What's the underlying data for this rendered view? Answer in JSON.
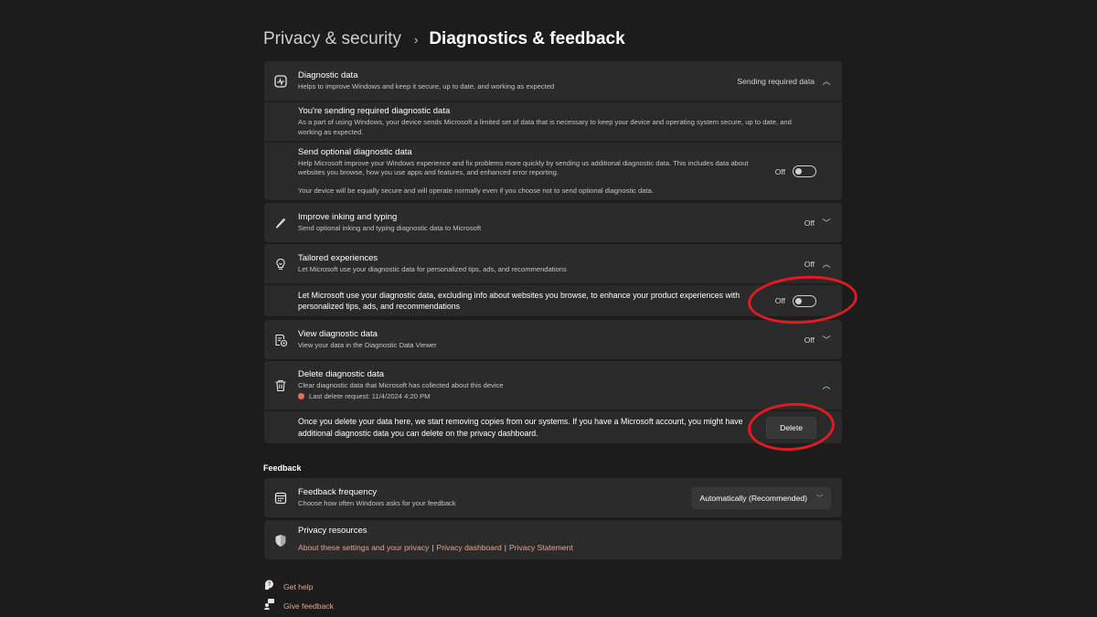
{
  "breadcrumb": {
    "parent": "Privacy & security",
    "separator": "›",
    "current": "Diagnostics & feedback"
  },
  "diagnostic_data": {
    "title": "Diagnostic data",
    "description": "Helps to improve Windows and keep it secure, up to date, and working as expected",
    "status": "Sending required data",
    "expanded": true,
    "required": {
      "title": "You're sending required diagnostic data",
      "description": "As a part of using Windows, your device sends Microsoft a limited set of data that is necessary to keep your device and operating system secure, up to date, and working as expected."
    },
    "optional": {
      "title": "Send optional diagnostic data",
      "description": "Help Microsoft improve your Windows experience and fix problems more quickly by sending us additional diagnostic data. This includes data about websites you browse, how you use apps and features, and enhanced error reporting.",
      "note": "Your device will be equally secure and will operate normally even if you choose not to send optional diagnostic data.",
      "toggle_label": "Off",
      "toggle_on": false
    }
  },
  "inking": {
    "title": "Improve inking and typing",
    "description": "Send optional inking and typing diagnostic data to Microsoft",
    "status": "Off"
  },
  "tailored": {
    "title": "Tailored experiences",
    "description": "Let Microsoft use your diagnostic data for personalized tips, ads, and recommendations",
    "status": "Off",
    "sub_text": "Let Microsoft use your diagnostic data, excluding info about websites you browse, to enhance your product experiences with personalized tips, ads, and recommendations",
    "toggle_label": "Off",
    "toggle_on": false
  },
  "view_data": {
    "title": "View diagnostic data",
    "description": "View your data in the Diagnostic Data Viewer",
    "status": "Off"
  },
  "delete_data": {
    "title": "Delete diagnostic data",
    "description": "Clear diagnostic data that Microsoft has collected about this device",
    "last_request": "Last delete request: 11/4/2024 4:20 PM",
    "sub_text": "Once you delete your data here, we start removing copies from our systems. If you have a Microsoft account, you might have additional diagnostic data you can delete on the privacy dashboard.",
    "button_label": "Delete"
  },
  "feedback": {
    "section_label": "Feedback",
    "frequency": {
      "title": "Feedback frequency",
      "description": "Choose how often Windows asks for your feedback",
      "selected": "Automatically (Recommended)"
    },
    "resources": {
      "title": "Privacy resources",
      "links": [
        "About these settings and your privacy",
        "Privacy dashboard",
        "Privacy Statement"
      ],
      "separator": "|"
    }
  },
  "footer": {
    "get_help": "Get help",
    "give_feedback": "Give feedback"
  },
  "colors": {
    "background": "#1c1c1c",
    "card": "#2b2b2b",
    "link": "#e8a48c",
    "annotation": "#e11b22"
  }
}
